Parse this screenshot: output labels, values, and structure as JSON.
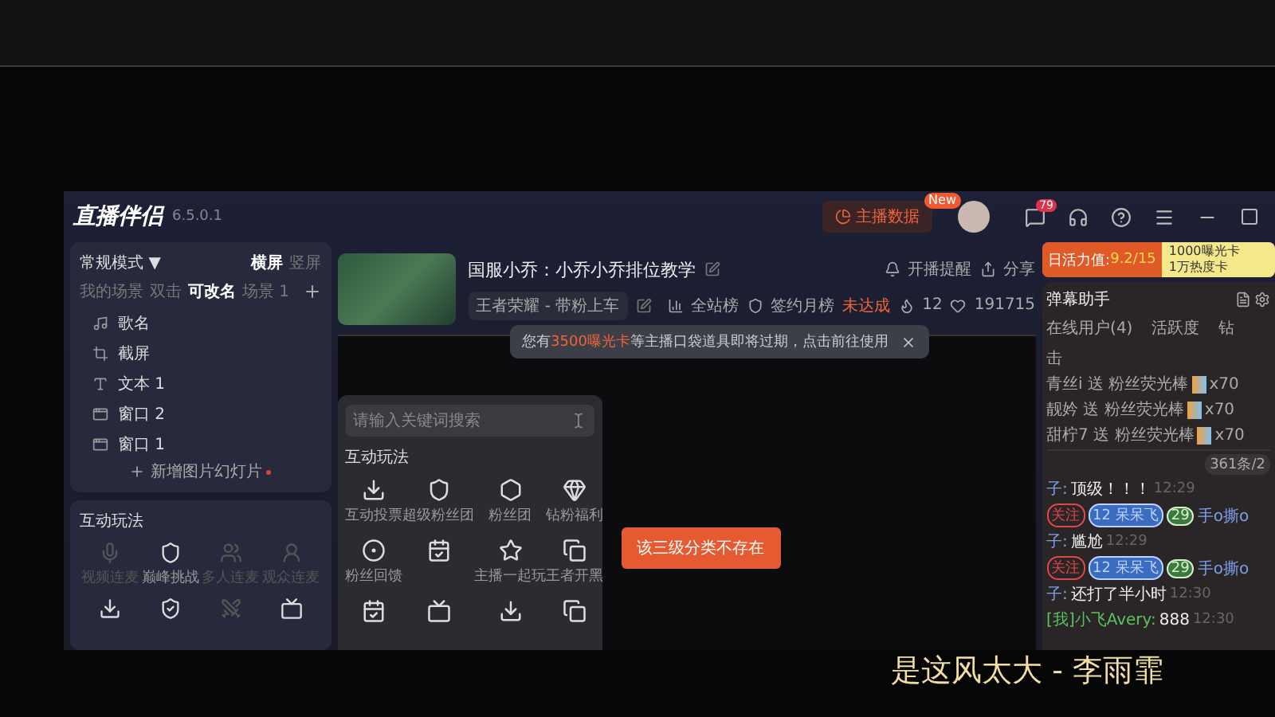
{
  "app": {
    "title": "直播伴侣",
    "version": "6.5.0.1"
  },
  "header": {
    "data_button": "主播数据",
    "new_badge": "New",
    "message_count": "79"
  },
  "scene_panel": {
    "mode": "常规模式",
    "mode_caret": "▼",
    "orientations": [
      {
        "label": "横屏",
        "selected": true
      },
      {
        "label": "竖屏",
        "selected": false
      }
    ],
    "tabs": [
      {
        "label": "我的场景",
        "selected": false
      },
      {
        "label": "双击",
        "selected": false
      },
      {
        "label": "可改名",
        "selected": true
      },
      {
        "label": "场景 1",
        "selected": false
      }
    ],
    "sources": [
      {
        "kind": "music",
        "label": "歌名"
      },
      {
        "kind": "crop",
        "label": "截屏"
      },
      {
        "kind": "text",
        "label": "文本 1"
      },
      {
        "kind": "window",
        "label": "窗口 2"
      },
      {
        "kind": "window",
        "label": "窗口 1"
      }
    ],
    "add_label": "新增图片幻灯片"
  },
  "interaction_panel": {
    "title": "互动玩法",
    "items": [
      {
        "label": "视频连麦",
        "disabled": true
      },
      {
        "label": "巅峰挑战",
        "disabled": false
      },
      {
        "label": "多人连麦",
        "disabled": true
      },
      {
        "label": "观众连麦",
        "disabled": true
      }
    ],
    "icon_row": [
      {
        "disabled": false
      },
      {
        "disabled": false
      },
      {
        "disabled": true
      },
      {
        "disabled": false
      }
    ]
  },
  "stream": {
    "title": "国服小乔：小乔小乔排位教学",
    "category": "王者荣耀 - 带粉上车",
    "rank": "全站榜",
    "monthly": "签约月榜",
    "monthly_status": "未达成",
    "flames": "12",
    "likes": "191715",
    "remind": "开播提醒",
    "share": "分享"
  },
  "notice": {
    "before": "您有",
    "highlight": "3500曝光卡",
    "after": "等主播口袋道具即将过期，点击前往使用"
  },
  "toast": "该三级分类不存在",
  "search_popup": {
    "placeholder": "请输入关键词搜索",
    "section": "互动玩法",
    "items": [
      {
        "kind": "labeled",
        "label": "互动投票"
      },
      {
        "kind": "labeled",
        "label": "超级粉丝团"
      },
      {
        "kind": "labeled",
        "label": "粉丝团"
      },
      {
        "kind": "labeled",
        "label": "钻粉福利"
      },
      {
        "kind": "labeled",
        "label": "粉丝回馈"
      },
      {
        "kind": "icon"
      },
      {
        "kind": "labeled",
        "label": "主播一起玩"
      },
      {
        "kind": "labeled",
        "label": "王者开黑"
      },
      {
        "kind": "icon"
      },
      {
        "kind": "icon"
      },
      {
        "kind": "icon"
      },
      {
        "kind": "icon"
      }
    ]
  },
  "chat": {
    "energy_label": "日活力值:",
    "energy_value": "9.2/15",
    "reward_lines": [
      "1000曝光卡",
      "1万热度卡"
    ],
    "title": "弹幕助手",
    "tabs": [
      {
        "label": "在线用户(4)",
        "selected": false
      },
      {
        "label": "活跃度",
        "selected": false
      },
      {
        "label": "钻",
        "selected": false
      }
    ],
    "gift_header": "击",
    "gifts": [
      {
        "text": "青丝i 送 粉丝荧光棒",
        "count": "x70"
      },
      {
        "text": "靓妗 送 粉丝荧光棒",
        "count": "x70"
      },
      {
        "text": "甜柠7 送 粉丝荧光棒",
        "count": "x70"
      }
    ],
    "count_badge": "361条/2",
    "messages": [
      {
        "kind": "comment",
        "user": "子:",
        "text": "顶级！！！",
        "time": "12:29"
      },
      {
        "kind": "badges",
        "follow": "关注",
        "level": "12",
        "fan_name": "呆呆飞",
        "fan_level": "29",
        "name": "手o撕o"
      },
      {
        "kind": "comment",
        "user": "子:",
        "text": "尴尬",
        "time": "12:29"
      },
      {
        "kind": "badges",
        "follow": "关注",
        "level": "12",
        "fan_name": "呆呆飞",
        "fan_level": "29",
        "name": "手o撕o"
      },
      {
        "kind": "comment",
        "user": "子:",
        "text": "还打了半小时",
        "time": "12:30"
      },
      {
        "kind": "self",
        "user": "[我]小飞Avery:",
        "text": "888",
        "time": "12:30"
      }
    ]
  },
  "lyric": "是这风太大 - 李雨霏"
}
